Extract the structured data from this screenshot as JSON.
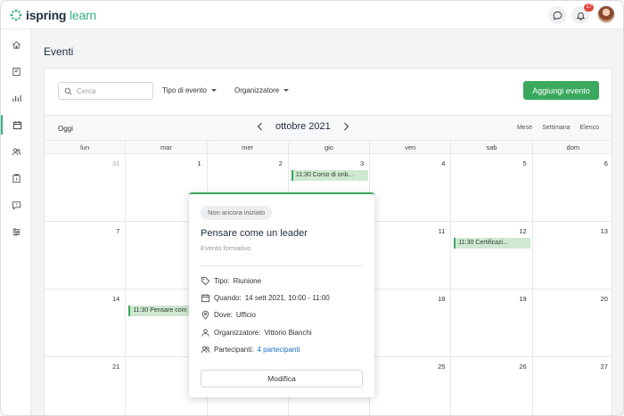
{
  "app": {
    "logo_name": "ispring",
    "logo_suffix": "learn"
  },
  "topbar": {
    "notification_count": "17"
  },
  "sidebar": {
    "items": [
      "home-icon",
      "book-icon",
      "chart-icon",
      "calendar-icon",
      "users-icon",
      "assignment-icon",
      "help-icon",
      "sliders-icon"
    ],
    "active": "calendar-icon"
  },
  "page": {
    "title": "Eventi"
  },
  "toolbar": {
    "search_placeholder": "Cerca",
    "filter_event_type": "Tipo di evento",
    "filter_organizer": "Organizzatore",
    "add_button": "Aggiungi evento"
  },
  "calendar": {
    "today_label": "Oggi",
    "month_label": "ottobre 2021",
    "views": [
      "Mese",
      "Settimana",
      "Elenco"
    ],
    "weekdays": [
      "lun",
      "mar",
      "mer",
      "gio",
      "ven",
      "sab",
      "dom"
    ],
    "weeks": [
      [
        {
          "day": "31",
          "muted": true
        },
        {
          "day": "1"
        },
        {
          "day": "2"
        },
        {
          "day": "3",
          "event": "11:30 Corso di onb..."
        },
        {
          "day": "4"
        },
        {
          "day": "5"
        },
        {
          "day": "6"
        }
      ],
      [
        {
          "day": "7"
        },
        {
          "day": ""
        },
        {
          "day": ""
        },
        {
          "day": ""
        },
        {
          "day": "11"
        },
        {
          "day": "12",
          "event": "11:30 Certificazi..."
        },
        {
          "day": "13"
        }
      ],
      [
        {
          "day": "14"
        },
        {
          "day": "",
          "event": "11:30 Pensare com"
        },
        {
          "day": ""
        },
        {
          "day": ""
        },
        {
          "day": "18"
        },
        {
          "day": "19"
        },
        {
          "day": "20"
        }
      ],
      [
        {
          "day": "21"
        },
        {
          "day": ""
        },
        {
          "day": ""
        },
        {
          "day": ""
        },
        {
          "day": "25"
        },
        {
          "day": "26"
        },
        {
          "day": "27"
        }
      ]
    ]
  },
  "popup": {
    "status": "Non ancora iniziato",
    "title": "Pensare come un leader",
    "subtitle": "Evento formativo",
    "type_label": "Tipo:",
    "type_value": "Riunione",
    "when_label": "Quando:",
    "when_value": "14 sett 2021, 10:00 - 11:00",
    "where_label": "Dove:",
    "where_value": "Ufficio",
    "organizer_label": "Organizzatore:",
    "organizer_value": "Vittorio Bianchi",
    "participants_label": "Partecipanti:",
    "participants_value": "4 partecipanti",
    "edit_button": "Modifica"
  },
  "colors": {
    "accent": "#3aa95e",
    "event_bg": "#cfe8d2",
    "link": "#1a73c8",
    "badge": "#e0473f"
  }
}
